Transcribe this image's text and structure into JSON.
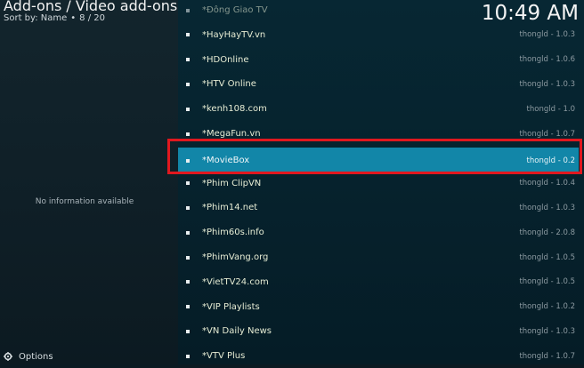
{
  "header": {
    "title": "Add-ons / Video add-ons",
    "sort_label": "Sort by: Name",
    "separator": "•",
    "position": "8 / 20"
  },
  "clock": "10:49 AM",
  "info_panel": {
    "message": "No information available"
  },
  "footer": {
    "options_label": "Options",
    "icon": "gear-icon"
  },
  "colors": {
    "selection": "#1286a8",
    "highlight_box": "#e0181f",
    "item_text": "#e6ecd4"
  },
  "addons": [
    {
      "name": "*Đông Giao TV",
      "version": ""
    },
    {
      "name": "*HayHayTV.vn",
      "version": "thongld - 1.0.3"
    },
    {
      "name": "*HDOnline",
      "version": "thongld - 1.0.6"
    },
    {
      "name": "*HTV Online",
      "version": "thongld - 1.0.3"
    },
    {
      "name": "*kenh108.com",
      "version": "thongld - 1.0"
    },
    {
      "name": "*MegaFun.vn",
      "version": "thongld - 1.0.7"
    },
    {
      "name": "*MovieBox",
      "version": "thongld - 0.2"
    },
    {
      "name": "*Phim ClipVN",
      "version": "thongld - 1.0.4"
    },
    {
      "name": "*Phim14.net",
      "version": "thongld - 1.0.3"
    },
    {
      "name": "*Phim60s.info",
      "version": "thongld - 2.0.8"
    },
    {
      "name": "*PhimVang.org",
      "version": "thongld - 1.0.5"
    },
    {
      "name": "*VietTV24.com",
      "version": "thongld - 1.0.5"
    },
    {
      "name": "*VIP Playlists",
      "version": "thongld - 1.0.2"
    },
    {
      "name": "*VN Daily News",
      "version": "thongld - 1.0.3"
    },
    {
      "name": "*VTV Plus",
      "version": "thongld - 1.0.7"
    }
  ],
  "selected_index": 6
}
